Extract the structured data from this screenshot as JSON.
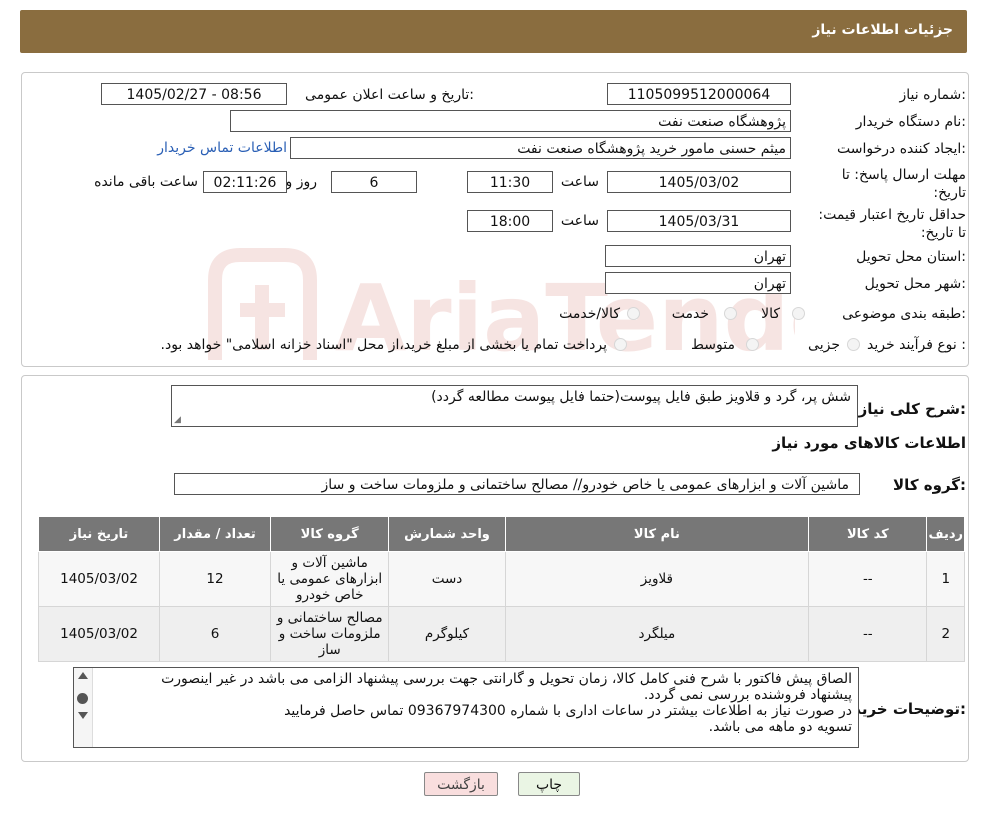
{
  "header": {
    "title": "جزئیات اطلاعات نیاز"
  },
  "watermark": {
    "text": "AriaTender.neT"
  },
  "details": {
    "need_number_label": "شماره نیاز:",
    "need_number": "1105099512000064",
    "announce_label": "تاریخ و ساعت اعلان عمومی:",
    "announce_value": "1405/02/27 - 08:56",
    "buyer_org_label": "نام دستگاه خریدار:",
    "buyer_org": "پژوهشگاه صنعت نفت",
    "requester_label": "ایجاد کننده درخواست:",
    "requester": "میثم حسنی مامور خرید پژوهشگاه صنعت نفت",
    "contact_link": "اطلاعات تماس خریدار",
    "deadline_label": "مهلت ارسال پاسخ: تا تاریخ:",
    "deadline_date": "1405/03/02",
    "time_label": "ساعت",
    "deadline_time": "11:30",
    "days_value": "6",
    "days_label": "روز و",
    "remaining_value": "02:11:26",
    "remaining_label": "ساعت باقی مانده",
    "validity_label": "حداقل تاریخ اعتبار قیمت: تا تاریخ:",
    "validity_date": "1405/03/31",
    "validity_time_label": "ساعت",
    "validity_time": "18:00",
    "province_label": "استان محل تحویل:",
    "province": "تهران",
    "city_label": "شهر محل تحویل:",
    "city": "تهران",
    "category_label": "طبقه بندی موضوعی:",
    "category_options": [
      "کالا",
      "خدمت",
      "کالا/خدمت"
    ],
    "process_label": "نوع فرآیند خرید :",
    "process_options": [
      "جزیی",
      "متوسط"
    ],
    "process_note": "پرداخت تمام یا بخشی از مبلغ خرید،از محل \"اسناد خزانه اسلامی\" خواهد بود."
  },
  "description": {
    "label": "شرح کلی نیاز:",
    "value": "شش پر، گرد و قلاویز طبق فایل پیوست(حتما فایل پیوست مطالعه گردد)"
  },
  "goods": {
    "section_title": "اطلاعات کالاهای مورد نیاز",
    "group_label": "گروه کالا:",
    "group_value": "ماشین آلات و ابزارهای عمومی یا خاص خودرو// مصالح ساختمانی و ملزومات ساخت و ساز"
  },
  "table": {
    "headers": [
      "ردیف",
      "کد کالا",
      "نام کالا",
      "واحد شمارش",
      "گروه کالا",
      "تعداد / مقدار",
      "تاریخ نیاز"
    ],
    "rows": [
      [
        "1",
        "--",
        "قلاویز",
        "دست",
        "ماشین آلات و ابزارهای عمومی یا خاص خودرو",
        "12",
        "1405/03/02"
      ],
      [
        "2",
        "--",
        "میلگرد",
        "کیلوگرم",
        "مصالح ساختمانی و ملزومات ساخت و ساز",
        "6",
        "1405/03/02"
      ]
    ]
  },
  "notes": {
    "label": "توضیحات خریدار:",
    "lines": [
      "الصاق پیش فاکتور با شرح فنی کامل کالا، زمان تحویل و گارانتی جهت بررسی پیشنهاد الزامی می باشد در غیر اینصورت",
      "پیشنهاد فروشنده بررسی نمی گردد.",
      "در صورت نیاز به اطلاعات بیشتر در ساعات اداری با شماره 09367974300 تماس حاصل فرمایید",
      "تسویه دو ماهه می باشد."
    ]
  },
  "buttons": {
    "print": "چاپ",
    "back": "بازگشت"
  }
}
